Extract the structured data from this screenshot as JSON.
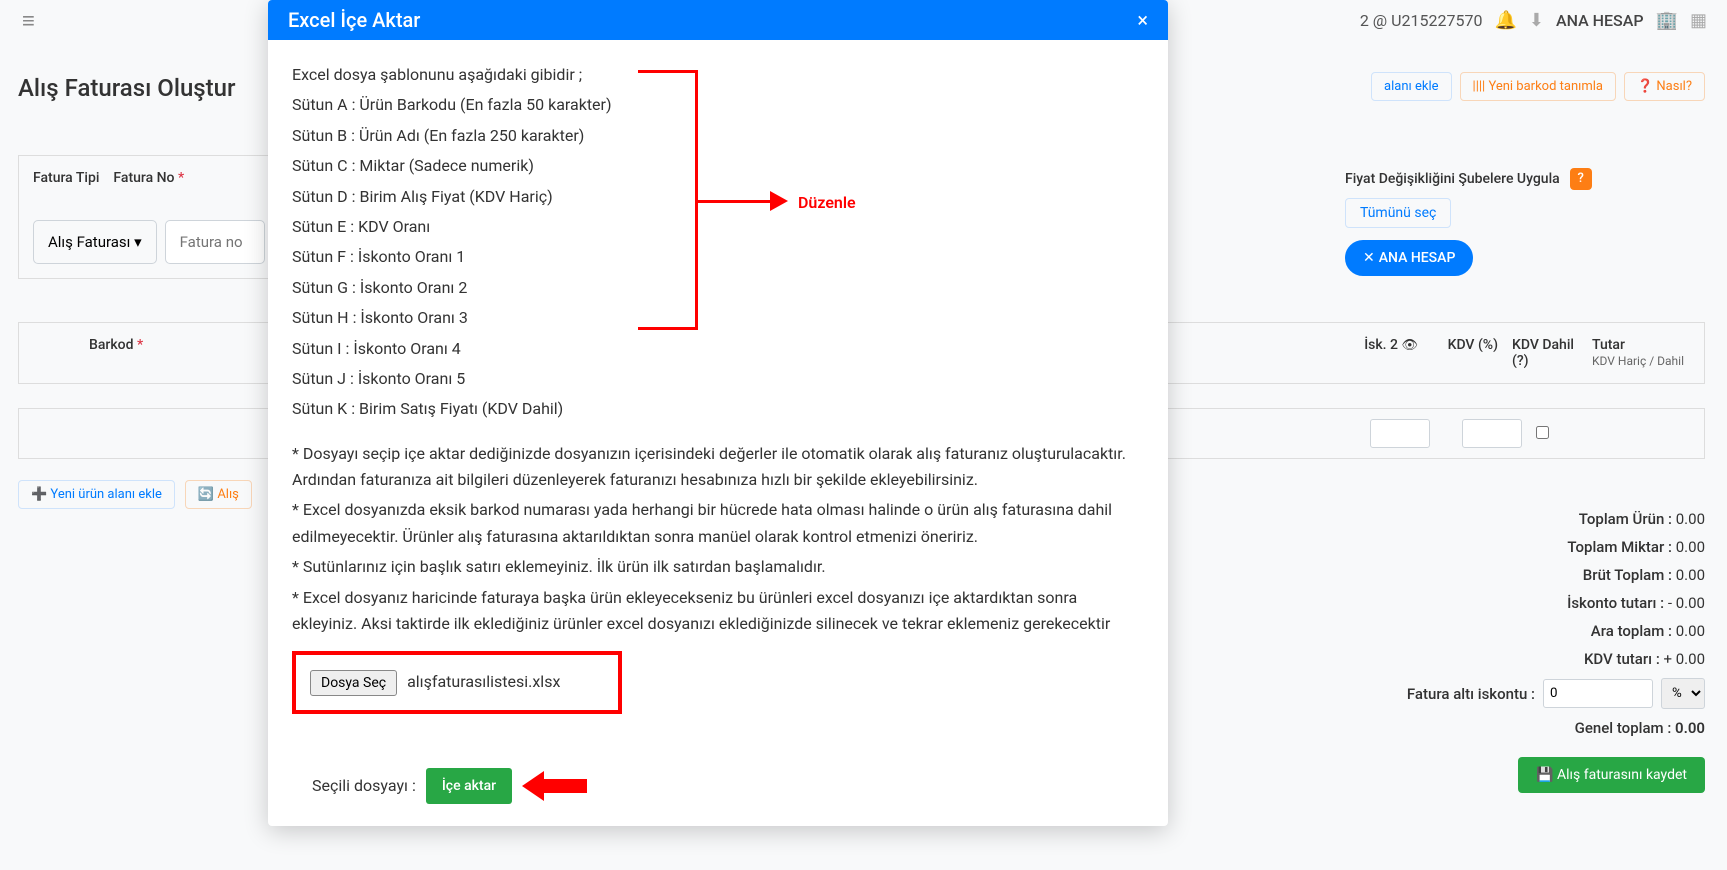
{
  "topbar": {
    "account_suffix": "2 @ U215227570",
    "main_account": "ANA HESAP"
  },
  "page": {
    "title": "Alış Faturası Oluştur",
    "btn_ekle": "alanı ekle",
    "btn_barkod": "Yeni barkod tanımla",
    "btn_nasil": "Nasıl?"
  },
  "form": {
    "fatura_tipi_label": "Fatura Tipi",
    "fatura_tipi_value": "Alış Faturası",
    "fatura_no_label": "Fatura No",
    "fatura_no_placeholder": "Fatura no",
    "asterisk": "*"
  },
  "right_panel": {
    "title": "Fiyat Değişikliğini Şubelere Uygula",
    "tumunu": "Tümünü seç",
    "pill": "ANA HESAP",
    "help": "?"
  },
  "table": {
    "barkod": "Barkod",
    "isk2": "İsk. 2",
    "kdv": "KDV (%)",
    "kdv_dahil": "KDV Dahil (?)",
    "tutar": "Tutar",
    "tutar_sub": "KDV Hariç / Dahil"
  },
  "actions": {
    "yeni": "Yeni ürün alanı ekle",
    "alis": "Alış"
  },
  "totals": {
    "urun": "Toplam Ürün :",
    "urun_val": "0.00",
    "miktar": "Toplam Miktar :",
    "miktar_val": "0.00",
    "brut": "Brüt Toplam :",
    "brut_val": "0.00",
    "iskonto": "İskonto tutarı :",
    "iskonto_val": "- 0.00",
    "ara": "Ara toplam :",
    "ara_val": "0.00",
    "kdvt": "KDV tutarı :",
    "kdvt_val": "+ 0.00",
    "fatura_alt": "Fatura altı iskontu :",
    "fatura_alt_val": "0",
    "pct": "%",
    "genel": "Genel toplam :",
    "genel_val": "0.00",
    "save": "Alış faturasını kaydet"
  },
  "modal": {
    "title": "Excel İçe Aktar",
    "intro": "Excel dosya şablonunu aşağıdaki gibidir ;",
    "cols": [
      "Sütun A : Ürün Barkodu (En fazla 50 karakter)",
      "Sütun B : Ürün Adı (En fazla 250 karakter)",
      "Sütun C : Miktar (Sadece numerik)",
      "Sütun D : Birim Alış Fiyat (KDV Hariç)",
      "Sütun E : KDV Oranı",
      "Sütun F : İskonto Oranı 1",
      "Sütun G : İskonto Oranı 2",
      "Sütun H : İskonto Oranı 3",
      "Sütun I : İskonto Oranı 4",
      "Sütun J : İskonto Oranı 5",
      "Sütun K : Birim Satış Fiyatı (KDV Dahil)"
    ],
    "note1": "* Dosyayı seçip içe aktar dediğinizde dosyanızın içerisindeki değerler ile otomatik olarak alış faturanız oluşturulacaktır. Ardından faturanıza ait bilgileri düzenleyerek faturanızı hesabınıza hızlı bir şekilde ekleyebilirsiniz.",
    "note2": "* Excel dosyanızda eksik barkod numarası yada herhangi bir hücrede hata olması halinde o ürün alış faturasına dahil edilmeyecektir. Ürünler alış faturasına aktarıldıktan sonra manüel olarak kontrol etmenizi öneririz.",
    "note3": "* Sutünlarınız için başlık satırı eklemeyiniz. İlk ürün ilk satırdan başlamalıdır.",
    "note4": "* Excel dosyanız haricinde faturaya başka ürün ekleyecekseniz bu ürünleri excel dosyanızı içe aktardıktan sonra ekleyiniz. Aksi taktirde ilk eklediğiniz ürünler excel dosyanızı eklediğinizde silinecek ve tekrar eklemeniz gerekecektir",
    "file_btn": "Dosya Seç",
    "file_name": "alışfaturasılistesi.xlsx",
    "selected_label": "Seçili dosyayı :",
    "import_btn": "İçe aktar",
    "ann_text": "Düzenle"
  }
}
